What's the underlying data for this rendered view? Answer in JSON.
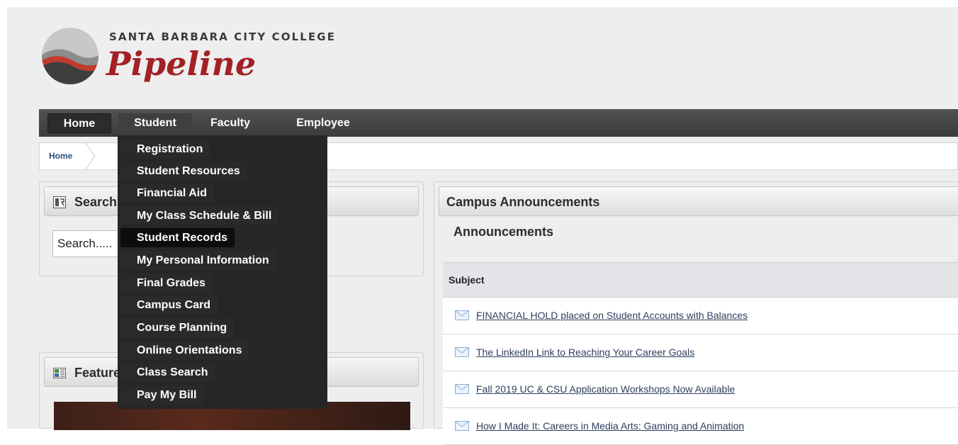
{
  "header": {
    "college_name": "SANTA BARBARA CITY COLLEGE",
    "portal_name": "Pipeline"
  },
  "nav": {
    "home": "Home",
    "student": "Student",
    "faculty": "Faculty",
    "employee": "Employee"
  },
  "breadcrumb": {
    "home": "Home"
  },
  "student_menu": {
    "items": [
      {
        "label": "Registration"
      },
      {
        "label": "Student Resources"
      },
      {
        "label": "Financial Aid"
      },
      {
        "label": "My Class Schedule & Bill"
      },
      {
        "label": "Student Records"
      },
      {
        "label": "My Personal Information"
      },
      {
        "label": "Final Grades"
      },
      {
        "label": "Campus Card"
      },
      {
        "label": "Course Planning"
      },
      {
        "label": "Online Orientations"
      },
      {
        "label": "Class Search"
      },
      {
        "label": "Pay My Bill"
      }
    ],
    "highlighted": "Student Records"
  },
  "search_portlet": {
    "title": "Search",
    "placeholder": "Search....."
  },
  "featured_portlet": {
    "title": "Featured"
  },
  "announcements": {
    "panel_title": "Campus Announcements",
    "subtitle": "Announcements",
    "column_header": "Subject",
    "rows": [
      {
        "subject": "FINANCIAL HOLD placed on Student Accounts with Balances"
      },
      {
        "subject": "The LinkedIn Link to Reaching Your Career Goals"
      },
      {
        "subject": "Fall 2019 UC & CSU Application Workshops Now Available"
      },
      {
        "subject": "How I Made It: Careers in Media Arts: Gaming and Animation"
      }
    ]
  },
  "colors": {
    "brand_red": "#a32125",
    "nav_dark": "#3b3b3b",
    "menu_bg": "#262626",
    "link": "#2f3e5c"
  },
  "icons": {
    "logo": "sbcc-wave-logo",
    "search_portlet": "search-portlet-icon",
    "featured_portlet": "featured-portlet-icon",
    "announcement": "mail-icon"
  }
}
